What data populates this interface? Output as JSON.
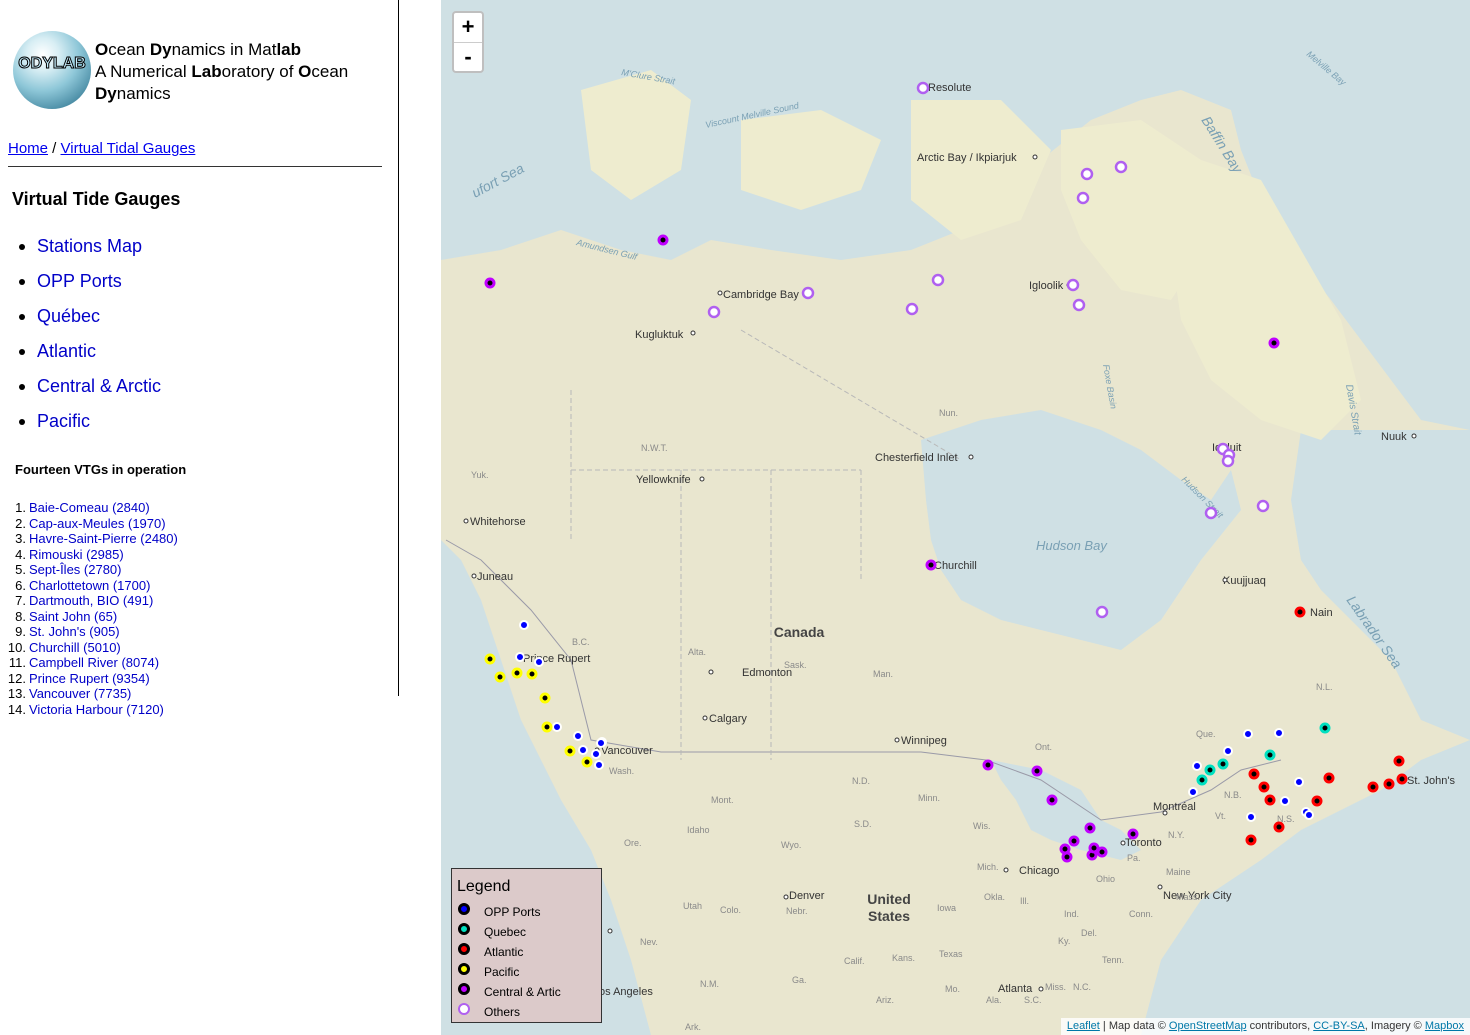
{
  "header": {
    "logo_text": "ODYLAB",
    "line1": [
      [
        "O",
        "b"
      ],
      [
        "cean ",
        ""
      ],
      [
        "Dy",
        "b"
      ],
      [
        "namics in Mat",
        ""
      ],
      [
        "lab",
        "b"
      ]
    ],
    "line2": [
      [
        "A Numerical ",
        ""
      ],
      [
        "Lab",
        "b"
      ],
      [
        "oratory of ",
        ""
      ],
      [
        "O",
        "b"
      ],
      [
        "cean",
        ""
      ]
    ],
    "line3": [
      [
        "Dy",
        "b"
      ],
      [
        "namics",
        ""
      ]
    ]
  },
  "breadcrumb": {
    "home": "Home",
    "sep": " / ",
    "current": "Virtual Tidal Gauges"
  },
  "section_title": "Virtual Tide Gauges",
  "nav": [
    "Stations Map",
    "OPP Ports",
    "Québec",
    "Atlantic",
    "Central & Arctic",
    "Pacific"
  ],
  "count_title": "Fourteen VTGs in operation",
  "vtgs": [
    "Baie-Comeau (2840)",
    "Cap-aux-Meules (1970)",
    "Havre-Saint-Pierre (2480)",
    "Rimouski (2985)",
    "Sept-Îles (2780)",
    "Charlottetown (1700)",
    "Dartmouth, BIO (491)",
    "Saint John (65)",
    "St. John's (905)",
    "Churchill (5010)",
    "Campbell River (8074)",
    "Prince Rupert (9354)",
    "Vancouver (7735)",
    "Victoria Harbour (7120)"
  ],
  "zoom": {
    "in": "+",
    "out": "-"
  },
  "legend": {
    "title": "Legend",
    "items": [
      {
        "label": "OPP Ports",
        "fill": "#0000ff",
        "stroke": "#000000"
      },
      {
        "label": "Quebec",
        "fill": "#00e0c0",
        "stroke": "#000000"
      },
      {
        "label": "Atlantic",
        "fill": "#ff0000",
        "stroke": "#000000"
      },
      {
        "label": "Pacific",
        "fill": "#ffff00",
        "stroke": "#000000"
      },
      {
        "label": "Central & Artic",
        "fill": "#c000ff",
        "stroke": "#000000"
      },
      {
        "label": "Others",
        "fill": "#ffffff",
        "stroke": "#b060f0"
      }
    ]
  },
  "attribution": {
    "leaflet": "Leaflet",
    "t1": " | Map data © ",
    "osm": "OpenStreetMap",
    "t2": " contributors, ",
    "lic": "CC-BY-SA",
    "t3": ", Imagery © ",
    "mapbox": "Mapbox"
  },
  "map_labels": {
    "seas": [
      "ufort Sea",
      "Baffin Bay",
      "Hudson Bay",
      "Labrador Sea",
      "M'Clure Strait",
      "Viscount Melville Sound",
      "Amundsen Gulf",
      "Melville Bay",
      "Davis Strait",
      "Hudson Strait",
      "Foxe Basin"
    ],
    "places": [
      "Resolute",
      "Arctic Bay / Ikpiarjuk",
      "Cambridge Bay",
      "Kugluktuk",
      "Igloolik",
      "Iqaluit",
      "Nuuk",
      "Chesterfield Inlet",
      "Yellowknife",
      "Whitehorse",
      "Juneau",
      "Churchill",
      "Kuujjuaq",
      "Nain",
      "Prince Rupert",
      "Edmonton",
      "Calgary",
      "Vancouver",
      "Winnipeg",
      "Montréal",
      "Toronto",
      "Chicago",
      "New York City",
      "Denver",
      "Atlanta",
      "St. John's",
      "os Angeles"
    ],
    "countries": [
      "Canada",
      "United States"
    ],
    "regions": [
      "Yuk.",
      "N.W.T.",
      "Nun.",
      "B.C.",
      "Alta.",
      "Sask.",
      "Man.",
      "Ont.",
      "Que.",
      "N.L.",
      "N.B.",
      "N.S.",
      "Wash.",
      "Ore.",
      "Idaho",
      "Mont.",
      "Wyo.",
      "N.D.",
      "S.D.",
      "Minn.",
      "Wis.",
      "Mich.",
      "Iowa",
      "Nebr.",
      "Colo.",
      "Utah",
      "Nev.",
      "Calif.",
      "Kans.",
      "Okla.",
      "Ill.",
      "Ind.",
      "Ohio",
      "Pa.",
      "N.Y.",
      "Vt.",
      "Maine",
      "Mass.",
      "Conn.",
      "Del.",
      "Ky.",
      "Tenn.",
      "N.C.",
      "S.C.",
      "Ala.",
      "Miss.",
      "Ga.",
      "N.M.",
      "Ariz.",
      "Texas",
      "Mo.",
      "Ark.",
      "B.C."
    ]
  }
}
